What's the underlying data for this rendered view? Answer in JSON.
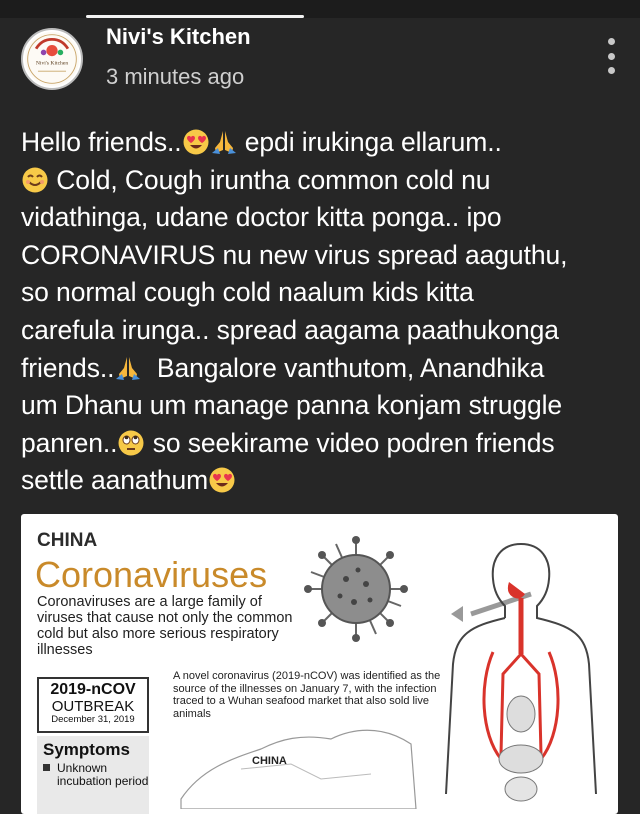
{
  "post": {
    "author": "Nivi's Kitchen",
    "avatar_text": "Nivi's Kitchen",
    "timestamp": "3 minutes ago",
    "text_lines": [
      "Hello friends..",
      " epdi irukinga ellarum..",
      " Cold, Cough iruntha common cold nu",
      "vidathinga, udane doctor kitta ponga.. ipo",
      "CORONAVIRUS nu new virus spread aaguthu,",
      "so normal cough cold naalum kids kitta",
      "carefula irunga.. spread aagama paathukonga",
      "friends..",
      "  Bangalore vanthutom, Anandhika",
      "um Dhanu um manage panna konjam struggle",
      "panren..",
      " so seekirame video podren friends",
      "settle aanathum"
    ]
  },
  "infographic": {
    "country": "CHINA",
    "title": "Coronaviruses",
    "description": "Coronaviruses are a large family of viruses that cause  not only the common cold but also more serious respiratory illnesses",
    "novel_text": "A novel coronavirus (2019-nCOV) was identified as the source of the illnesses on January 7, with the infection traced to a Wuhan seafood market that also sold live animals",
    "outbreak_year": "2019-nCOV",
    "outbreak_word": "OUTBREAK",
    "outbreak_date": "December 31, 2019",
    "symptoms_heading": "Symptoms",
    "symptom_item": "Unknown incubation period",
    "map_label": "CHINA"
  },
  "icons": {
    "heart_eyes": "heart-eyes-emoji",
    "folded_hands": "folded-hands-emoji",
    "smiling": "smiling-face-emoji",
    "eye_roll": "face-with-rolling-eyes-emoji",
    "menu": "more-vertical-icon"
  },
  "colors": {
    "background": "#262626",
    "title_accent": "#c98a2a",
    "organ_red": "#d9332b"
  }
}
